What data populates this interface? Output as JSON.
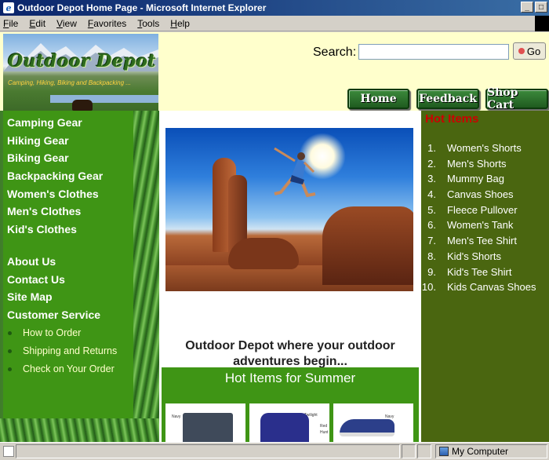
{
  "window": {
    "title": "Outdoor Depot Home Page - Microsoft Internet Explorer"
  },
  "menu": [
    "File",
    "Edit",
    "View",
    "Favorites",
    "Tools",
    "Help"
  ],
  "logo": {
    "title": "Outdoor Depot",
    "tagline": "Camping, Hiking, Biking and Backpacking ..."
  },
  "search": {
    "label": "Search:",
    "value": "",
    "go_label": "Go"
  },
  "nav": {
    "home": "Home",
    "feedback": "Feedback",
    "cart": "Shop Cart"
  },
  "left_nav": {
    "categories": [
      "Camping Gear",
      "Hiking Gear",
      "Biking Gear",
      "Backpacking Gear",
      "Women's Clothes",
      "Men's Clothes",
      "Kid's Clothes"
    ],
    "info": [
      "About Us",
      "Contact Us",
      "Site Map",
      "Customer Service"
    ],
    "service_links": [
      "How to Order",
      "Shipping and Returns",
      "Check on Your Order"
    ]
  },
  "main": {
    "tagline": "Outdoor Depot where your outdoor adventures begin...",
    "hot_summer_title": "Hot Items for Summer",
    "product_tags": [
      "Navy",
      "Twilight",
      "Red",
      "Hunt",
      "Navy"
    ]
  },
  "hot_items": {
    "title": "Hot Items",
    "items": [
      {
        "num": "1.",
        "name": "Women's Shorts"
      },
      {
        "num": "2.",
        "name": "Men's Shorts"
      },
      {
        "num": "3.",
        "name": "Mummy Bag"
      },
      {
        "num": "4.",
        "name": "Canvas Shoes"
      },
      {
        "num": "5.",
        "name": "Fleece Pullover"
      },
      {
        "num": "6.",
        "name": "Women's Tank"
      },
      {
        "num": "7.",
        "name": "Men's Tee Shirt"
      },
      {
        "num": "8.",
        "name": "Kid's Shorts"
      },
      {
        "num": "9.",
        "name": "Kid's Tee Shirt"
      },
      {
        "num": "10.",
        "name": "Kids Canvas Shoes"
      }
    ]
  },
  "status": {
    "zone": "My Computer"
  },
  "colors": {
    "nav_green": "#3f9515",
    "hot_items_bg": "#4a6610",
    "hot_items_title": "#cc0000",
    "page_bg": "#ffffcc"
  }
}
